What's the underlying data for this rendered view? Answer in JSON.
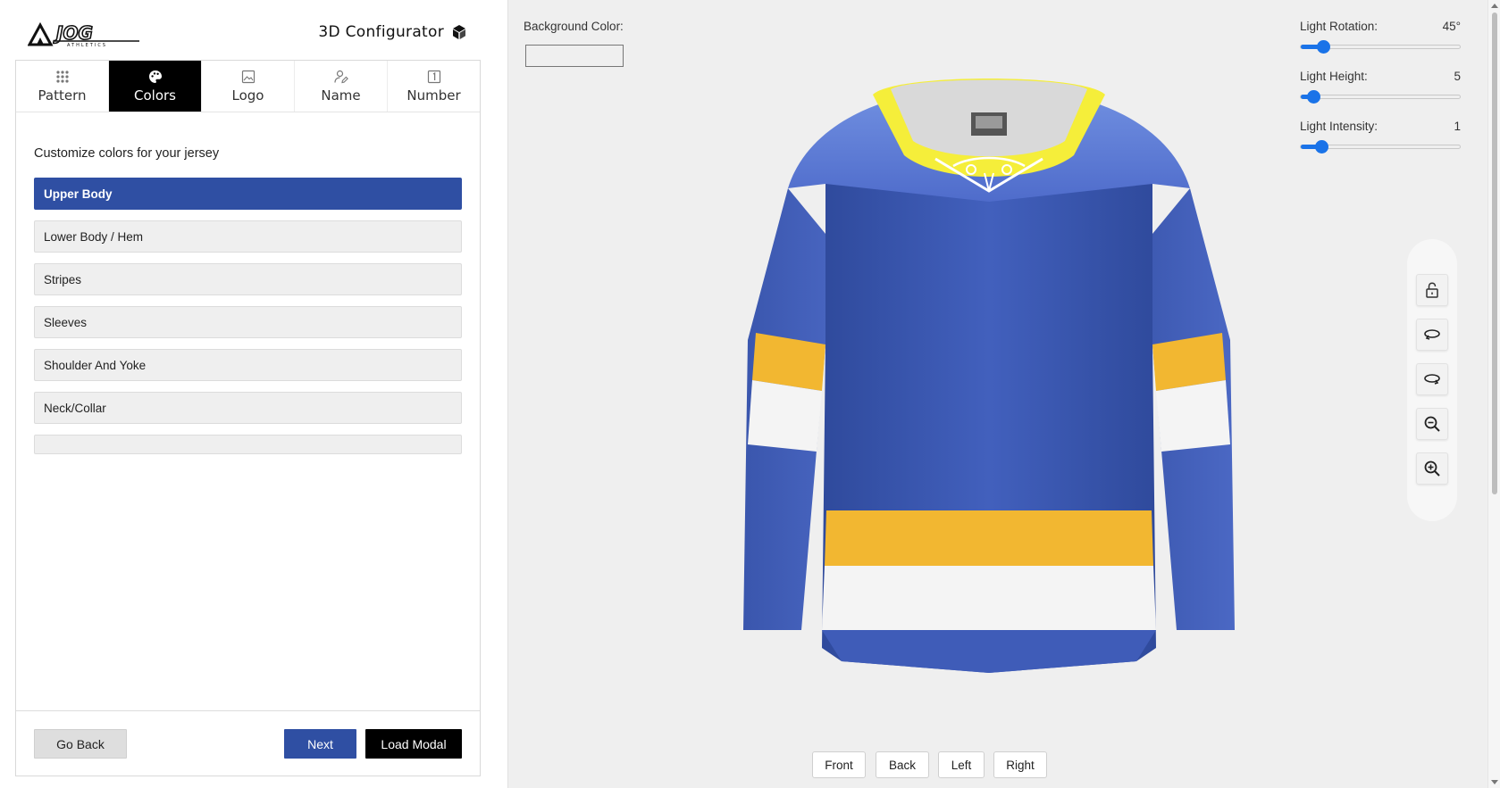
{
  "header": {
    "brand_logo_icon": "jog-athletics-logo",
    "title": "3D Configurator",
    "title_icon": "cube-icon"
  },
  "tabs": [
    {
      "label": "Pattern",
      "icon": "grid-dots-icon",
      "active": false
    },
    {
      "label": "Colors",
      "icon": "palette-icon",
      "active": true
    },
    {
      "label": "Logo",
      "icon": "image-icon",
      "active": false
    },
    {
      "label": "Name",
      "icon": "person-pen-icon",
      "active": false
    },
    {
      "label": "Number",
      "icon": "number-box-icon",
      "active": false
    }
  ],
  "colors_panel": {
    "heading": "Customize colors for your jersey",
    "parts": [
      {
        "label": "Upper Body",
        "active": true
      },
      {
        "label": "Lower Body / Hem",
        "active": false
      },
      {
        "label": "Stripes",
        "active": false
      },
      {
        "label": "Sleeves",
        "active": false
      },
      {
        "label": "Shoulder And Yoke",
        "active": false
      },
      {
        "label": "Neck/Collar",
        "active": false
      },
      {
        "label": "",
        "active": false
      }
    ]
  },
  "footer": {
    "go_back": "Go Back",
    "next": "Next",
    "load_modal": "Load Modal"
  },
  "viewport": {
    "background_color_label": "Background Color:",
    "background_color_value": "#efefef",
    "sliders": [
      {
        "label": "Light Rotation:",
        "value": "45°",
        "fraction": 0.14
      },
      {
        "label": "Light Height:",
        "value": "5",
        "fraction": 0.08
      },
      {
        "label": "Light Intensity:",
        "value": "1",
        "fraction": 0.13
      }
    ],
    "tools": [
      "unlock-icon",
      "rotate-left-icon",
      "rotate-right-icon",
      "zoom-out-icon",
      "zoom-in-icon"
    ],
    "views": [
      "Front",
      "Back",
      "Left",
      "Right"
    ]
  },
  "jersey_colors": {
    "body": "#3f5cb8",
    "stripe_gold": "#f2b731",
    "stripe_white": "#f4f4f4",
    "collar": "#f5ee3a"
  }
}
